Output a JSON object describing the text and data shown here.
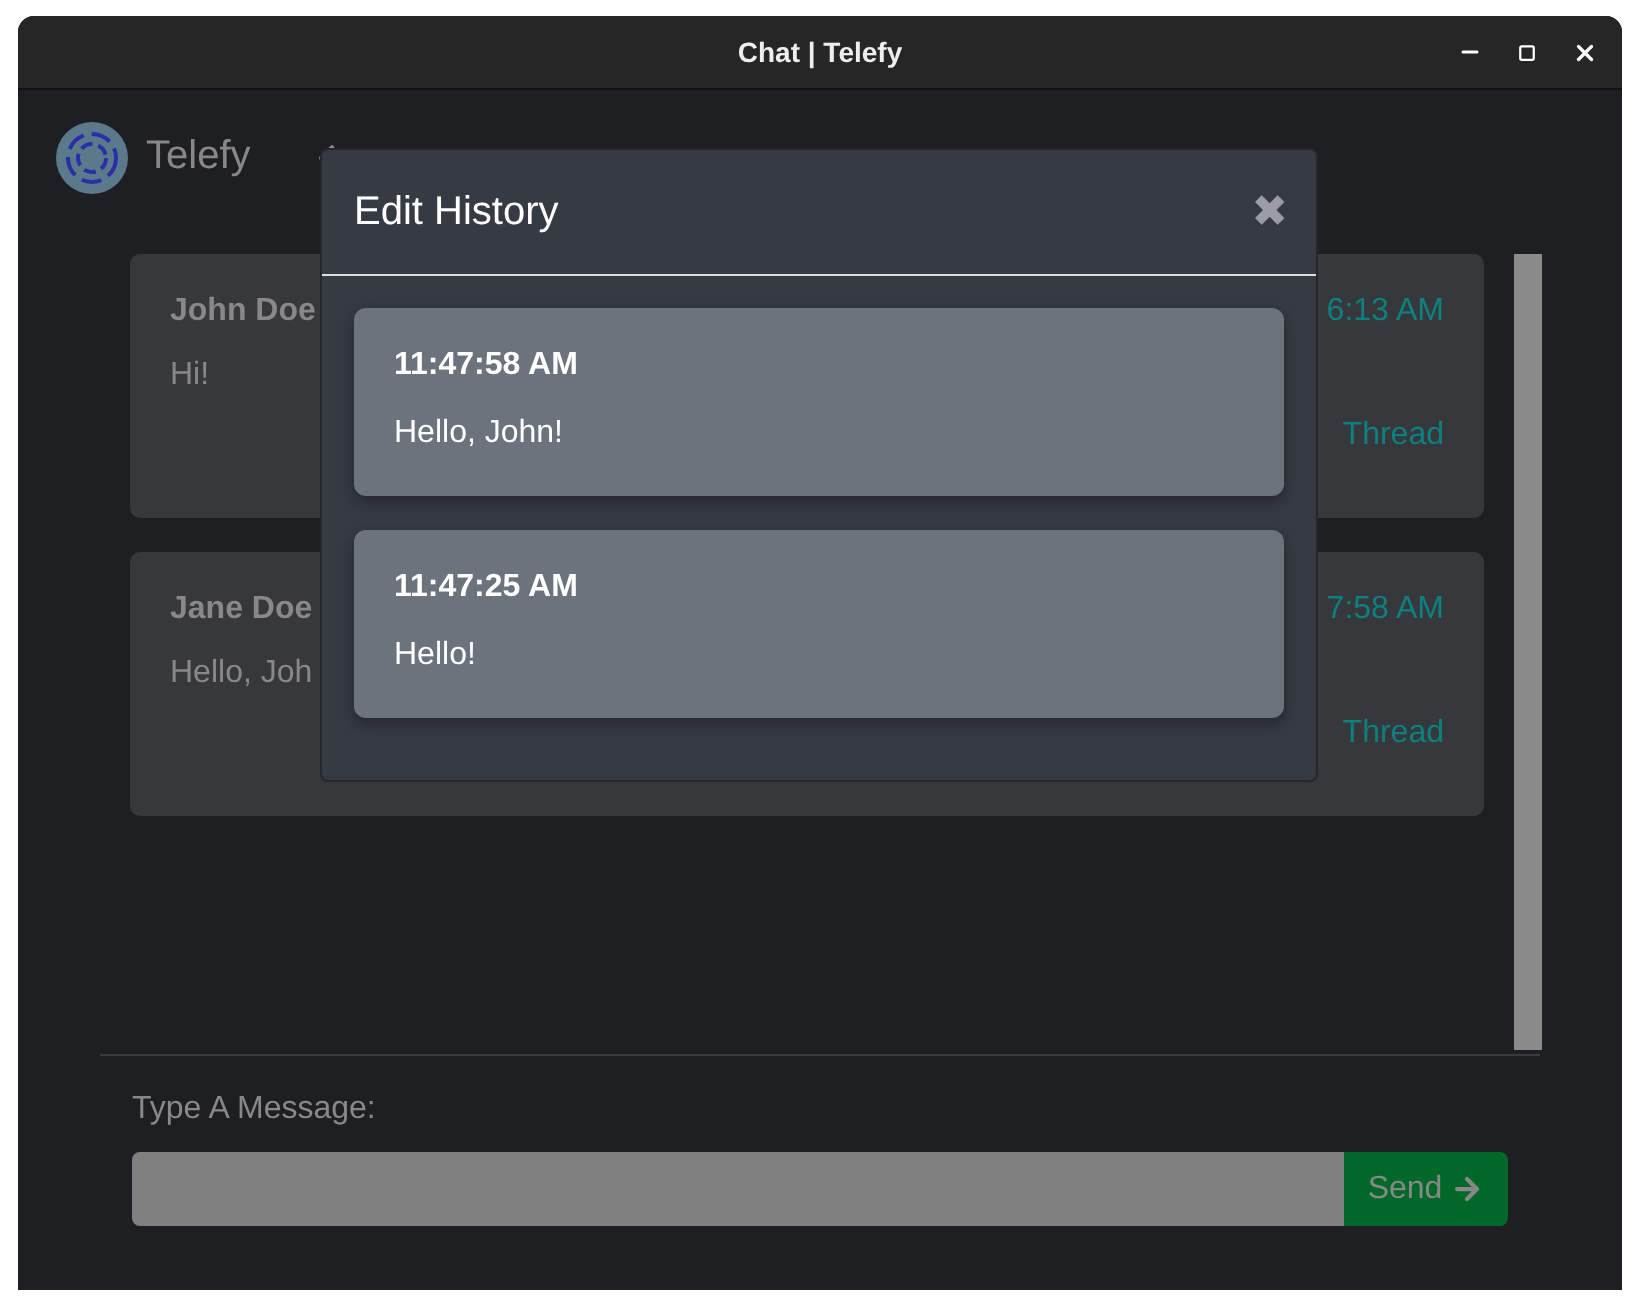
{
  "window": {
    "title": "Chat | Telefy"
  },
  "app": {
    "name": "Telefy"
  },
  "messages": [
    {
      "author": "John Doe",
      "text": "Hi!",
      "time": "6:13 AM",
      "thread": "Thread"
    },
    {
      "author": "Jane Doe",
      "text": "Hello, Joh",
      "time": "7:58 AM",
      "thread": "Thread"
    }
  ],
  "composer": {
    "label": "Type A Message:",
    "send": "Send"
  },
  "modal": {
    "title": "Edit History",
    "close": "✖",
    "entries": [
      {
        "time": "11:47:58 AM",
        "text": "Hello, John!"
      },
      {
        "time": "11:47:25 AM",
        "text": "Hello!"
      }
    ]
  }
}
